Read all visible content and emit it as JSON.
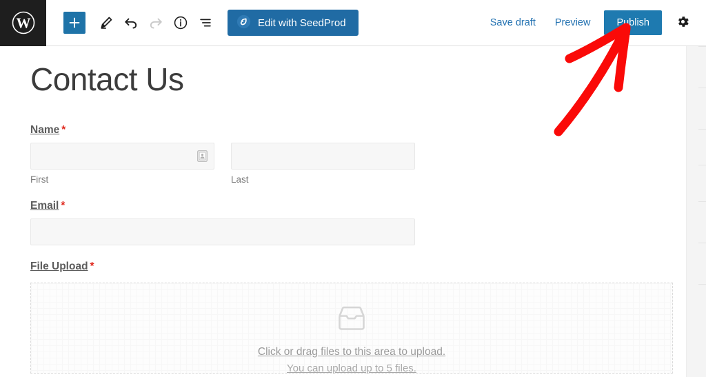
{
  "window": {
    "app": "WordPress Block Editor"
  },
  "topbar": {
    "logo_icon": "wordpress-logo-icon",
    "tools": [
      {
        "name": "add-block-button",
        "icon": "plus-icon",
        "label": "Add block",
        "variant": "primary",
        "enabled": true
      },
      {
        "name": "edit-tool-button",
        "icon": "pencil-icon",
        "label": "Edit",
        "variant": "plain",
        "enabled": true
      },
      {
        "name": "undo-button",
        "icon": "undo-icon",
        "label": "Undo",
        "variant": "plain",
        "enabled": true
      },
      {
        "name": "redo-button",
        "icon": "redo-icon",
        "label": "Redo",
        "variant": "plain",
        "enabled": false
      },
      {
        "name": "details-button",
        "icon": "info-icon",
        "label": "Details",
        "variant": "plain",
        "enabled": true
      },
      {
        "name": "list-view-button",
        "icon": "list-view-icon",
        "label": "List View",
        "variant": "plain",
        "enabled": true
      }
    ],
    "seedprod": {
      "label": "Edit with SeedProd",
      "icon": "seedprod-leaf-icon",
      "bg_color": "#206ba4"
    },
    "save_draft_label": "Save draft",
    "preview_label": "Preview",
    "publish_label": "Publish",
    "publish_bg_color": "#1e7ab0",
    "link_color": "#2271b1",
    "settings_icon": "gear-icon"
  },
  "annotation": {
    "type": "arrow",
    "color": "#fa0a08",
    "points_to": "publish-button"
  },
  "editor": {
    "page_title": "Contact Us",
    "form": {
      "name_field": {
        "label": "Name",
        "required_mark": "*",
        "first": {
          "value": "",
          "placeholder": "",
          "sub_label": "First",
          "autofill_icon": "contact-card-icon"
        },
        "last": {
          "value": "",
          "placeholder": "",
          "sub_label": "Last"
        }
      },
      "email_field": {
        "label": "Email",
        "required_mark": "*",
        "value": "",
        "placeholder": ""
      },
      "file_upload_field": {
        "label": "File Upload",
        "required_mark": "*",
        "dropzone_icon": "inbox-tray-icon",
        "dropzone_line1": "Click or drag files to this area to upload.",
        "dropzone_line2": "You can upload up to 5 files."
      }
    }
  }
}
